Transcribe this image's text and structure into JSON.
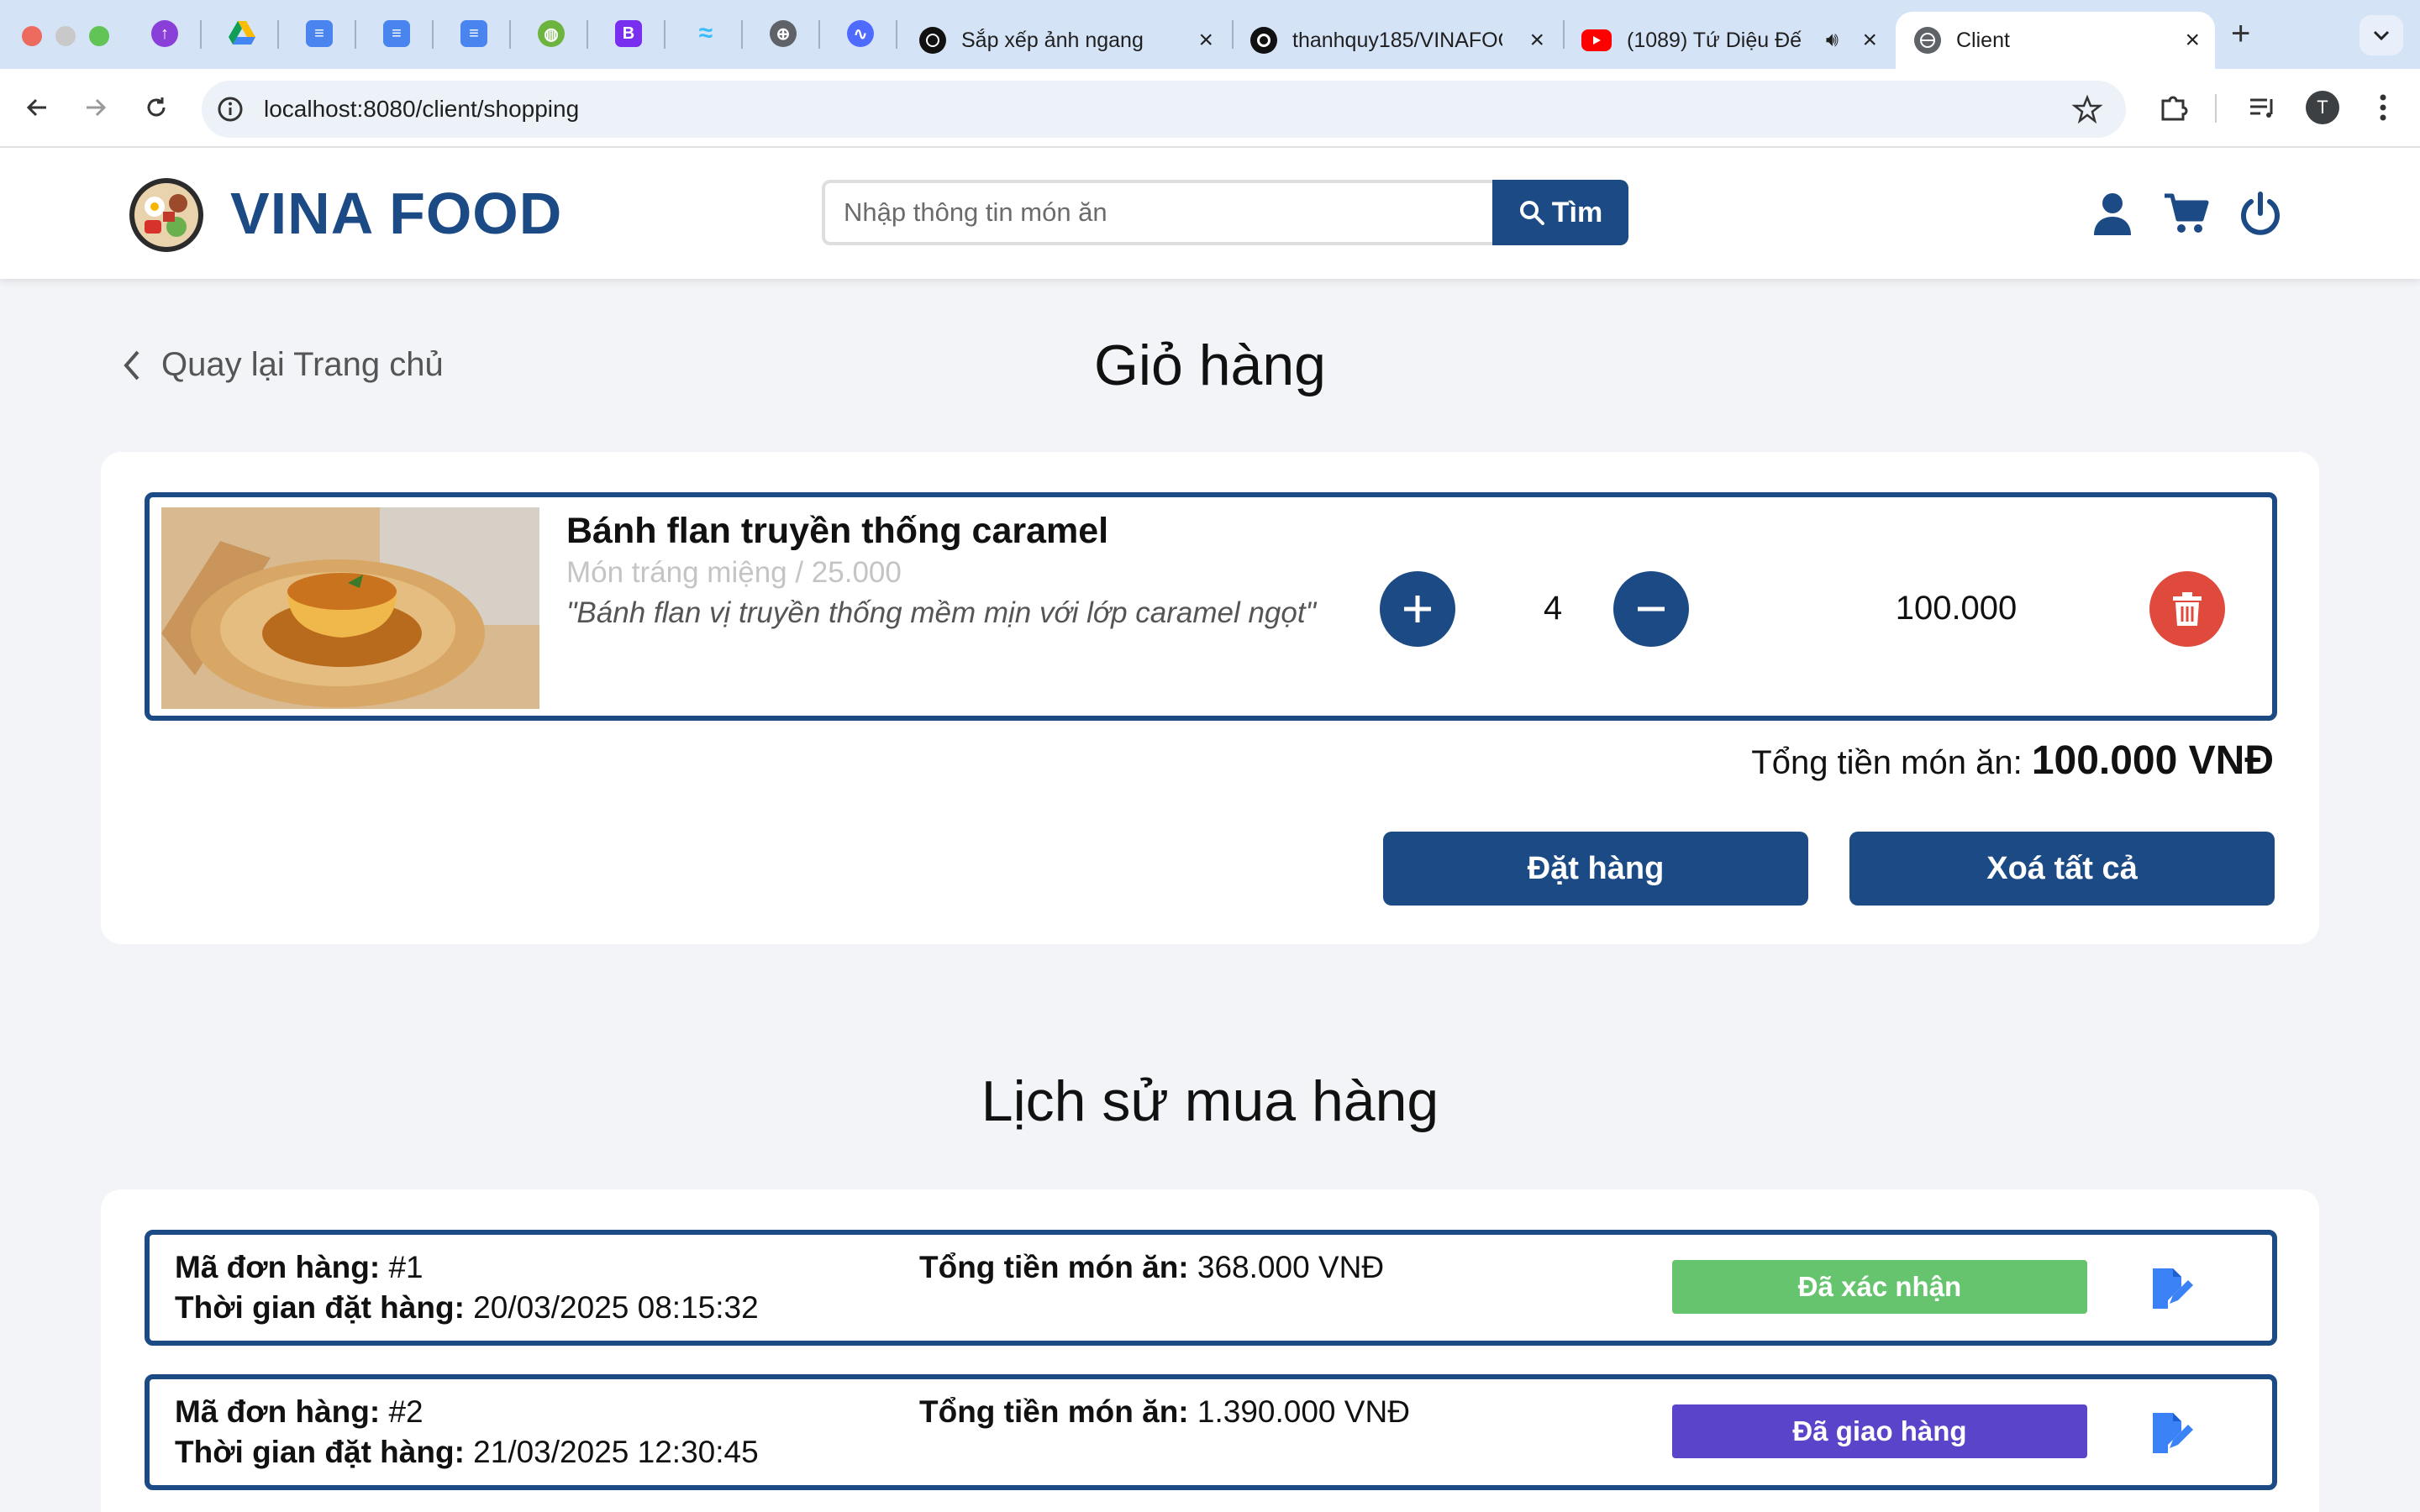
{
  "browser": {
    "tabs": [
      {
        "title": "Sắp xếp ảnh ngang"
      },
      {
        "title": "thanhquy185/VINAFOOD"
      },
      {
        "title": "(1089) Tứ Diệu Đế"
      },
      {
        "title": "Client"
      }
    ],
    "url": "localhost:8080/client/shopping",
    "profile_initial": "T"
  },
  "site": {
    "brand": "VINA FOOD",
    "search_placeholder": "Nhập thông tin món ăn",
    "search_button": "Tìm"
  },
  "cart": {
    "back_label": "Quay lại Trang chủ",
    "title": "Giỏ hàng",
    "items": [
      {
        "name": "Bánh flan truyền thống caramel",
        "meta": "Món tráng miệng / 25.000",
        "description": "\"Bánh flan vị truyền thống mềm mịn với lớp caramel ngọt\"",
        "quantity": "4",
        "subtotal": "100.000"
      }
    ],
    "total_label": "Tổng tiền món ăn:",
    "total_value": "100.000 VNĐ",
    "order_button": "Đặt hàng",
    "clear_button": "Xoá tất cả"
  },
  "history": {
    "title": "Lịch sử mua hàng",
    "orders": [
      {
        "id_label": "Mã đơn hàng:",
        "id": "#1",
        "time_label": "Thời gian đặt hàng:",
        "time": "20/03/2025 08:15:32",
        "total_label": "Tổng tiền món ăn:",
        "total": "368.000 VNĐ",
        "status": "Đã xác nhận",
        "status_color": "#66c46e"
      },
      {
        "id_label": "Mã đơn hàng:",
        "id": "#2",
        "time_label": "Thời gian đặt hàng:",
        "time": "21/03/2025 12:30:45",
        "total_label": "Tổng tiền món ăn:",
        "total": "1.390.000 VNĐ",
        "status": "Đã giao hàng",
        "status_color": "#5a44c9"
      }
    ]
  },
  "colors": {
    "brand": "#1c4a85",
    "danger": "#e04a3d",
    "confirmed": "#66c46e",
    "delivered": "#5a44c9"
  }
}
